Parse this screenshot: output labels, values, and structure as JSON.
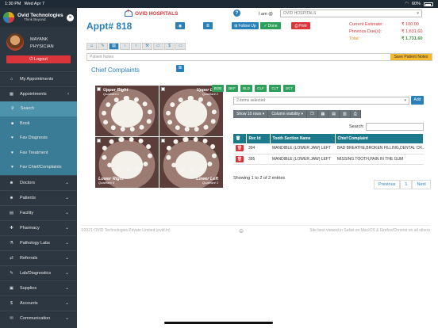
{
  "status_bar": {
    "time": "1:30 PM",
    "date": "Wed Apr 7",
    "battery": "60%"
  },
  "sidebar": {
    "brand_name": "Ovid Technologies",
    "brand_tagline": "Think Beyond",
    "user_name": "MAYANK",
    "user_role": "PHYSICIAN",
    "logout_label": "Logout",
    "items": [
      {
        "label": "My Appointments",
        "icon": "home-icon"
      },
      {
        "label": "Appointments",
        "icon": "calendar-icon"
      }
    ],
    "subitems": [
      {
        "label": "Search"
      },
      {
        "label": "Book"
      },
      {
        "label": "Fav Diagnosis"
      },
      {
        "label": "Fav Treatment"
      },
      {
        "label": "Fav Chief/Complaints"
      }
    ],
    "more_items": [
      {
        "label": "Doctors",
        "icon": "doctor-icon"
      },
      {
        "label": "Patients",
        "icon": "patients-icon"
      },
      {
        "label": "Facility",
        "icon": "building-icon"
      },
      {
        "label": "Pharmacy",
        "icon": "pharmacy-icon"
      },
      {
        "label": "Pathology Labs",
        "icon": "lab-icon"
      },
      {
        "label": "Referrals",
        "icon": "referral-icon"
      },
      {
        "label": "Lab/Diagnostics",
        "icon": "diagnostics-icon"
      },
      {
        "label": "Supplies",
        "icon": "supplies-icon"
      },
      {
        "label": "Accounts",
        "icon": "accounts-icon"
      },
      {
        "label": "Communication",
        "icon": "communication-icon"
      }
    ]
  },
  "header": {
    "hospital_name": "OVID HOSPITALS",
    "appt_title": "Appt# 818",
    "follow_up_label": "Follow Up",
    "done_label": "Done",
    "print_label": "Print",
    "i_am_label": "I am @",
    "hospital_select_value": "OVID HOSPITALS",
    "estimate_label": "Current Estimate:",
    "previous_due_label": "Previous Due(s):",
    "total_label": "Total:",
    "estimate_value": "₹ 100.00",
    "previous_due_value": "₹ 1,631.60",
    "total_value": "₹ 1,731.60"
  },
  "notes": {
    "placeholder": "Patient Notes",
    "save_label": "Save Patient Notes"
  },
  "section": {
    "title": "Chief Complaints"
  },
  "teeth": {
    "q1_name": "Upper Right",
    "q1_sub": "Quadrant 1",
    "q2_name": "Upper Left",
    "q2_sub": "Quadrant 2",
    "q3_name": "Lower Left",
    "q3_sub": "Quadrant 3",
    "q4_name": "Lower Right",
    "q4_sub": "Quadrant 4"
  },
  "codes": [
    "BOB",
    "BKF",
    "BLD",
    "CLF",
    "CLT",
    "DCT"
  ],
  "items_select": {
    "value": "2 items selected",
    "add_label": "Add"
  },
  "toolbar": {
    "show_rows": "Show 10 rows",
    "column_visibility": "Column visibility",
    "search_label": "Search:"
  },
  "table": {
    "headers": [
      "Rec Id",
      "Tooth Section Name",
      "Chief Complaint"
    ],
    "rows": [
      [
        "394",
        "MANDIBLE (LOWER JAW) LEFT",
        "BAD BREATHE,BROKEN FILLING,DENTAL CR..."
      ],
      [
        "395",
        "MANDIBLE (LOWER JAW) LEFT",
        "MISSING TOOTH,PAIN IN THE GUM"
      ]
    ]
  },
  "pagination": {
    "info": "Showing 1 to 2 of 2 entries",
    "previous": "Previous",
    "page": "1",
    "next": "Next"
  },
  "footer": {
    "copyright": "©2021 OVID Technologies Private Limited (ovid.in)",
    "best_viewed": "Site best viewed in Safari on MacIOS & Firefox/Chrome on all others"
  },
  "colors": {
    "primary": "#2a80b9",
    "sidebar": "#2d3741",
    "subnav": "#3a7c95",
    "danger": "#d9353a",
    "success": "#2ea05a",
    "warning": "#f5b92c"
  }
}
